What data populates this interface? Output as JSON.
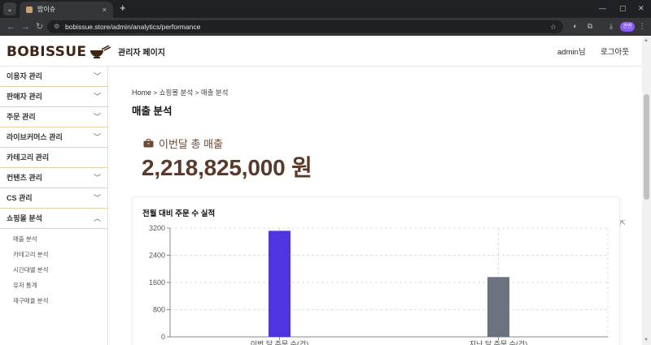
{
  "browser": {
    "tab_title": "밥이슈",
    "tab_close": "×",
    "new_tab": "+",
    "url": "bobissue.store/admin/analytics/performance",
    "profile_label": "관련",
    "minimize": "—",
    "maximize": "▢",
    "close": "✕"
  },
  "header": {
    "logo": "BOBISSUE",
    "admin_title": "관리자 페이지",
    "user": "admin님",
    "logout": "로그아웃"
  },
  "sidebar": {
    "items": [
      {
        "label": "이용자 관리",
        "chevron": "﹀"
      },
      {
        "label": "판매자 관리",
        "chevron": "﹀"
      },
      {
        "label": "주문 관리",
        "chevron": "﹀"
      },
      {
        "label": "라이브커머스 관리",
        "chevron": "﹀"
      },
      {
        "label": "카테고리 관리",
        "chevron": ""
      },
      {
        "label": "컨텐츠 관리",
        "chevron": "﹀"
      },
      {
        "label": "CS 관리",
        "chevron": "﹀"
      },
      {
        "label": "쇼핑몰 분석",
        "chevron": "︿"
      }
    ],
    "subitems": [
      "매출 분석",
      "카테고리 분석",
      "시간대별 분석",
      "유저 통계",
      "재구매율 분석"
    ]
  },
  "content": {
    "breadcrumb": {
      "home": "Home",
      "sep1": " > ",
      "level1": "쇼핑몰 분석",
      "sep2": " > ",
      "level2": "매출 분석"
    },
    "page_title": "매출 분석",
    "revenue_label": "이번달 총 매출",
    "revenue_value": "2,218,825,000 원"
  },
  "chart_data": {
    "type": "bar",
    "title": "전월 대비 주문 수 실적",
    "categories": [
      "이번 달 주문 수(건)",
      "지난 달 주문 수(건)"
    ],
    "values": [
      3120,
      1760
    ],
    "colors": [
      "#4f35e0",
      "#6b7280"
    ],
    "yticks": [
      0,
      800,
      1600,
      2400,
      3200
    ],
    "ylim": [
      0,
      3200
    ],
    "grid": true
  },
  "colors": {
    "accent_brown": "#5b3a2a",
    "border_tan": "#e9cfa6"
  }
}
